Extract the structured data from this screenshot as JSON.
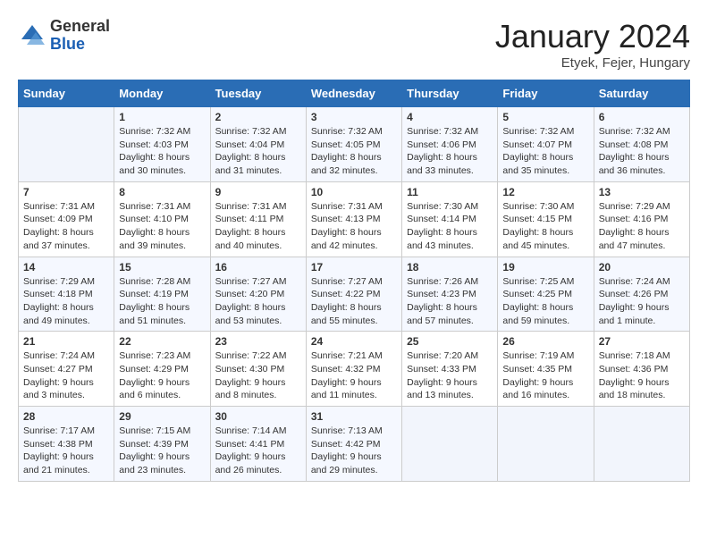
{
  "logo": {
    "general": "General",
    "blue": "Blue"
  },
  "title": {
    "month_year": "January 2024",
    "location": "Etyek, Fejer, Hungary"
  },
  "days_of_week": [
    "Sunday",
    "Monday",
    "Tuesday",
    "Wednesday",
    "Thursday",
    "Friday",
    "Saturday"
  ],
  "weeks": [
    [
      {
        "day": "",
        "sunrise": "",
        "sunset": "",
        "daylight": ""
      },
      {
        "day": "1",
        "sunrise": "Sunrise: 7:32 AM",
        "sunset": "Sunset: 4:03 PM",
        "daylight": "Daylight: 8 hours and 30 minutes."
      },
      {
        "day": "2",
        "sunrise": "Sunrise: 7:32 AM",
        "sunset": "Sunset: 4:04 PM",
        "daylight": "Daylight: 8 hours and 31 minutes."
      },
      {
        "day": "3",
        "sunrise": "Sunrise: 7:32 AM",
        "sunset": "Sunset: 4:05 PM",
        "daylight": "Daylight: 8 hours and 32 minutes."
      },
      {
        "day": "4",
        "sunrise": "Sunrise: 7:32 AM",
        "sunset": "Sunset: 4:06 PM",
        "daylight": "Daylight: 8 hours and 33 minutes."
      },
      {
        "day": "5",
        "sunrise": "Sunrise: 7:32 AM",
        "sunset": "Sunset: 4:07 PM",
        "daylight": "Daylight: 8 hours and 35 minutes."
      },
      {
        "day": "6",
        "sunrise": "Sunrise: 7:32 AM",
        "sunset": "Sunset: 4:08 PM",
        "daylight": "Daylight: 8 hours and 36 minutes."
      }
    ],
    [
      {
        "day": "7",
        "sunrise": "Sunrise: 7:31 AM",
        "sunset": "Sunset: 4:09 PM",
        "daylight": "Daylight: 8 hours and 37 minutes."
      },
      {
        "day": "8",
        "sunrise": "Sunrise: 7:31 AM",
        "sunset": "Sunset: 4:10 PM",
        "daylight": "Daylight: 8 hours and 39 minutes."
      },
      {
        "day": "9",
        "sunrise": "Sunrise: 7:31 AM",
        "sunset": "Sunset: 4:11 PM",
        "daylight": "Daylight: 8 hours and 40 minutes."
      },
      {
        "day": "10",
        "sunrise": "Sunrise: 7:31 AM",
        "sunset": "Sunset: 4:13 PM",
        "daylight": "Daylight: 8 hours and 42 minutes."
      },
      {
        "day": "11",
        "sunrise": "Sunrise: 7:30 AM",
        "sunset": "Sunset: 4:14 PM",
        "daylight": "Daylight: 8 hours and 43 minutes."
      },
      {
        "day": "12",
        "sunrise": "Sunrise: 7:30 AM",
        "sunset": "Sunset: 4:15 PM",
        "daylight": "Daylight: 8 hours and 45 minutes."
      },
      {
        "day": "13",
        "sunrise": "Sunrise: 7:29 AM",
        "sunset": "Sunset: 4:16 PM",
        "daylight": "Daylight: 8 hours and 47 minutes."
      }
    ],
    [
      {
        "day": "14",
        "sunrise": "Sunrise: 7:29 AM",
        "sunset": "Sunset: 4:18 PM",
        "daylight": "Daylight: 8 hours and 49 minutes."
      },
      {
        "day": "15",
        "sunrise": "Sunrise: 7:28 AM",
        "sunset": "Sunset: 4:19 PM",
        "daylight": "Daylight: 8 hours and 51 minutes."
      },
      {
        "day": "16",
        "sunrise": "Sunrise: 7:27 AM",
        "sunset": "Sunset: 4:20 PM",
        "daylight": "Daylight: 8 hours and 53 minutes."
      },
      {
        "day": "17",
        "sunrise": "Sunrise: 7:27 AM",
        "sunset": "Sunset: 4:22 PM",
        "daylight": "Daylight: 8 hours and 55 minutes."
      },
      {
        "day": "18",
        "sunrise": "Sunrise: 7:26 AM",
        "sunset": "Sunset: 4:23 PM",
        "daylight": "Daylight: 8 hours and 57 minutes."
      },
      {
        "day": "19",
        "sunrise": "Sunrise: 7:25 AM",
        "sunset": "Sunset: 4:25 PM",
        "daylight": "Daylight: 8 hours and 59 minutes."
      },
      {
        "day": "20",
        "sunrise": "Sunrise: 7:24 AM",
        "sunset": "Sunset: 4:26 PM",
        "daylight": "Daylight: 9 hours and 1 minute."
      }
    ],
    [
      {
        "day": "21",
        "sunrise": "Sunrise: 7:24 AM",
        "sunset": "Sunset: 4:27 PM",
        "daylight": "Daylight: 9 hours and 3 minutes."
      },
      {
        "day": "22",
        "sunrise": "Sunrise: 7:23 AM",
        "sunset": "Sunset: 4:29 PM",
        "daylight": "Daylight: 9 hours and 6 minutes."
      },
      {
        "day": "23",
        "sunrise": "Sunrise: 7:22 AM",
        "sunset": "Sunset: 4:30 PM",
        "daylight": "Daylight: 9 hours and 8 minutes."
      },
      {
        "day": "24",
        "sunrise": "Sunrise: 7:21 AM",
        "sunset": "Sunset: 4:32 PM",
        "daylight": "Daylight: 9 hours and 11 minutes."
      },
      {
        "day": "25",
        "sunrise": "Sunrise: 7:20 AM",
        "sunset": "Sunset: 4:33 PM",
        "daylight": "Daylight: 9 hours and 13 minutes."
      },
      {
        "day": "26",
        "sunrise": "Sunrise: 7:19 AM",
        "sunset": "Sunset: 4:35 PM",
        "daylight": "Daylight: 9 hours and 16 minutes."
      },
      {
        "day": "27",
        "sunrise": "Sunrise: 7:18 AM",
        "sunset": "Sunset: 4:36 PM",
        "daylight": "Daylight: 9 hours and 18 minutes."
      }
    ],
    [
      {
        "day": "28",
        "sunrise": "Sunrise: 7:17 AM",
        "sunset": "Sunset: 4:38 PM",
        "daylight": "Daylight: 9 hours and 21 minutes."
      },
      {
        "day": "29",
        "sunrise": "Sunrise: 7:15 AM",
        "sunset": "Sunset: 4:39 PM",
        "daylight": "Daylight: 9 hours and 23 minutes."
      },
      {
        "day": "30",
        "sunrise": "Sunrise: 7:14 AM",
        "sunset": "Sunset: 4:41 PM",
        "daylight": "Daylight: 9 hours and 26 minutes."
      },
      {
        "day": "31",
        "sunrise": "Sunrise: 7:13 AM",
        "sunset": "Sunset: 4:42 PM",
        "daylight": "Daylight: 9 hours and 29 minutes."
      },
      {
        "day": "",
        "sunrise": "",
        "sunset": "",
        "daylight": ""
      },
      {
        "day": "",
        "sunrise": "",
        "sunset": "",
        "daylight": ""
      },
      {
        "day": "",
        "sunrise": "",
        "sunset": "",
        "daylight": ""
      }
    ]
  ]
}
